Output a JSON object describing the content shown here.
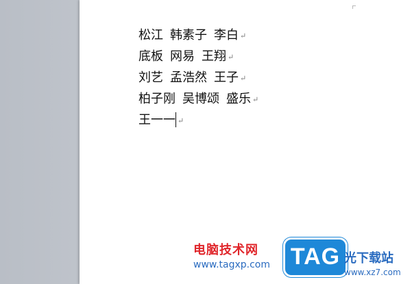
{
  "document": {
    "lines": [
      {
        "segments": [
          "松江",
          "韩素子",
          "李白"
        ]
      },
      {
        "segments": [
          "底板",
          "网易",
          "王翔"
        ]
      },
      {
        "segments": [
          "刘艺",
          "孟浩然",
          "王子"
        ]
      },
      {
        "segments": [
          "柏子刚",
          "吴博颂",
          "盛乐"
        ]
      },
      {
        "segments": [
          "王一一"
        ]
      }
    ],
    "paragraph_mark": "↵"
  },
  "watermark": {
    "cn_name": "电脑技术网",
    "url": "www.tagxp.com",
    "badge": "TAG",
    "site_name": "光下载站",
    "site_url": "www.xz7.com"
  },
  "colors": {
    "brand_red": "#e0262b",
    "brand_blue": "#1e88d8"
  }
}
